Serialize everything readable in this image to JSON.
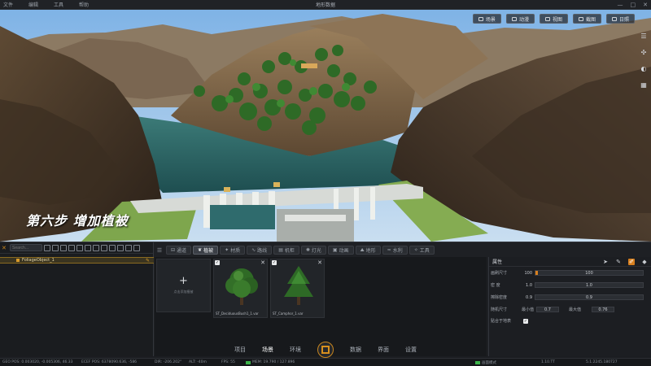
{
  "menu": [
    "文件",
    "编辑",
    "工具",
    "帮助"
  ],
  "app_title": "地形数据",
  "window_controls": [
    "—",
    "□",
    "✕"
  ],
  "viewport": {
    "caption": "第六步  增加植被",
    "toolbar": [
      {
        "label": "场景",
        "icon": "image-icon"
      },
      {
        "label": "动漫",
        "icon": "film-icon"
      },
      {
        "label": "视图",
        "icon": "view-icon"
      },
      {
        "label": "截图",
        "icon": "screenshot-icon"
      },
      {
        "label": "日照",
        "icon": "sun-icon"
      }
    ],
    "side_tools": [
      "☰",
      "✣",
      "◐",
      "▦"
    ]
  },
  "left_panel": {
    "search_placeholder": "Search...",
    "tree_item": "FoliageObject_1"
  },
  "tabs": [
    {
      "label": "通道",
      "icon": "channel-icon"
    },
    {
      "label": "植被",
      "icon": "leaf-icon",
      "active": true
    },
    {
      "label": "材质",
      "icon": "material-icon"
    },
    {
      "label": "路线",
      "icon": "route-icon"
    },
    {
      "label": "机柜",
      "icon": "cabinet-icon"
    },
    {
      "label": "灯光",
      "icon": "light-icon"
    },
    {
      "label": "动画",
      "icon": "anim-icon"
    },
    {
      "label": "地形",
      "icon": "terrain-icon"
    },
    {
      "label": "水利",
      "icon": "water-icon"
    },
    {
      "label": "工具",
      "icon": "tool-icon"
    }
  ],
  "assets": {
    "add_label": "点击添加植被",
    "items": [
      {
        "name": "ST_DeciduousBush1_1.var"
      },
      {
        "name": "ST_Camphor_1.var"
      }
    ]
  },
  "properties": {
    "title": "属性",
    "rows": [
      {
        "label": "画刷尺寸",
        "num": "100",
        "value": "100",
        "fill": 0.02
      },
      {
        "label": "密 度",
        "num": "1.0",
        "value": "1.0",
        "fill": 0
      },
      {
        "label": "擦除密度",
        "num": "0.9",
        "value": "0.9",
        "fill": 0
      }
    ],
    "random": {
      "label": "随机尺寸",
      "min_label": "最小值",
      "min": "0.7",
      "max_label": "最大值",
      "max": "0.76"
    },
    "snap": {
      "label": "贴合于地表"
    }
  },
  "bottom_nav": {
    "items_left": [
      "项目",
      "场景",
      "环境"
    ],
    "items_right": [
      "数据",
      "界面",
      "设置"
    ],
    "active": "场景"
  },
  "status": {
    "geo": "GEO POS: 0.003020, -0.005306, 46.33",
    "ecef": "ECEF POS: 6378090.636, -586",
    "dir": "DIR: -206.202°",
    "alt": "ALT: -40m",
    "fps": "FPS: 55",
    "mem": "MEM: 19.790 / 127.896",
    "draw": "画面模式",
    "time": "1.10.TT",
    "ver": "5.1.2245.180727"
  }
}
